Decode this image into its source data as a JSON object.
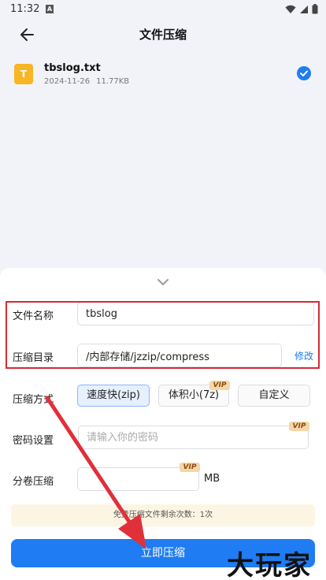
{
  "status_bar": {
    "time": "11:32"
  },
  "header": {
    "title": "文件压缩"
  },
  "file": {
    "name": "tbslog.txt",
    "icon_letter": "T",
    "date": "2024-11-26",
    "size": "11.77KB",
    "selected": true
  },
  "form": {
    "file_name": {
      "label": "文件名称",
      "value": "tbslog"
    },
    "directory": {
      "label": "压缩目录",
      "value": "/内部存储/jzzip/compress",
      "edit_label": "修改"
    },
    "method": {
      "label": "压缩方式",
      "options": [
        "速度快(zip)",
        "体积小(7z)",
        "自定义"
      ],
      "selected": "速度快(zip)"
    },
    "password": {
      "label": "密码设置",
      "placeholder": "请输入你的密码"
    },
    "split": {
      "label": "分卷压缩",
      "value": "",
      "unit": "MB"
    },
    "vip_badge": "VIP"
  },
  "notice": "免费压缩文件剩余次数：1次",
  "submit_label": "立即压缩",
  "watermark": "大玩家",
  "colors": {
    "accent": "#1f7cf2",
    "highlight": "#d32b35",
    "file_icon": "#f8b524"
  }
}
